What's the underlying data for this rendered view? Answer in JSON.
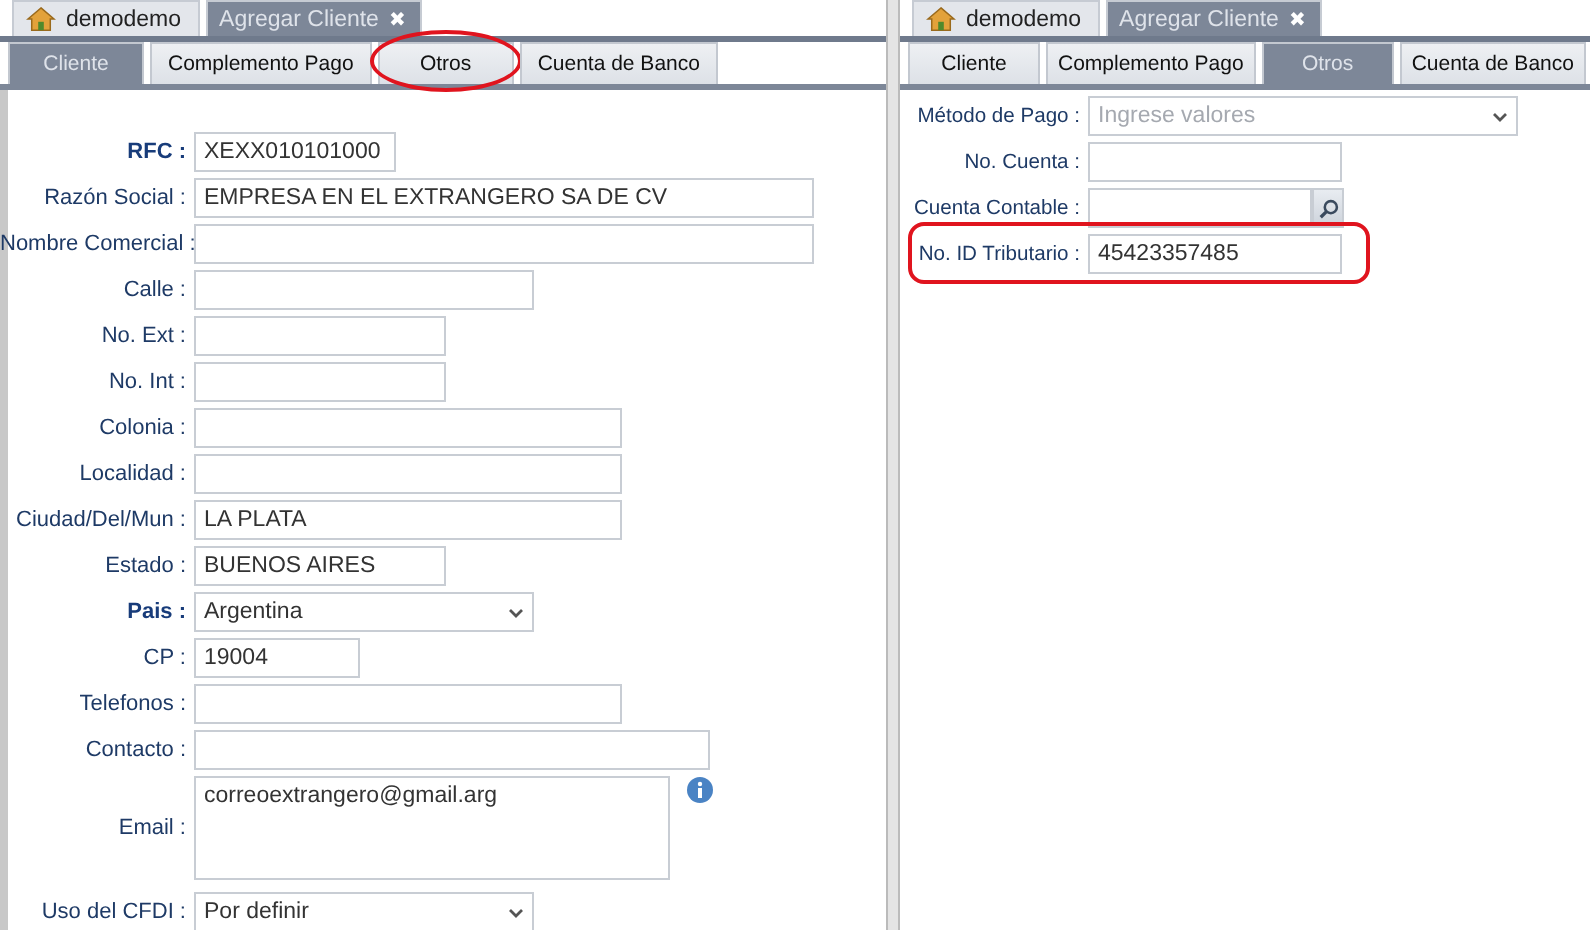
{
  "panes": [
    {
      "top_tabs": [
        {
          "label": "demodemo",
          "selected": false
        },
        {
          "label": "Agregar Cliente",
          "close": "✖",
          "selected": true
        }
      ],
      "sub_tabs": [
        {
          "label": "Cliente",
          "selected": true,
          "highlighted": false
        },
        {
          "label": "Complemento Pago",
          "selected": false,
          "highlighted": false
        },
        {
          "label": "Otros",
          "selected": false,
          "highlighted": true
        },
        {
          "label": "Cuenta de Banco",
          "selected": false,
          "highlighted": false
        }
      ],
      "fields": [
        {
          "label": "RFC :",
          "kind": "text",
          "value": "XEXX010101000",
          "required": true,
          "highlighted": false
        },
        {
          "label": "Razón Social :",
          "kind": "text",
          "value": "EMPRESA EN EL EXTRANGERO SA DE CV",
          "required": false,
          "highlighted": false
        },
        {
          "label": "Nombre Comercial :",
          "kind": "text",
          "required": false,
          "highlighted": false
        },
        {
          "label": "Calle :",
          "kind": "text",
          "required": false,
          "highlighted": false
        },
        {
          "label": "No. Ext :",
          "kind": "text",
          "required": false,
          "highlighted": false
        },
        {
          "label": "No. Int :",
          "kind": "text",
          "required": false,
          "highlighted": false
        },
        {
          "label": "Colonia :",
          "kind": "text",
          "required": false,
          "highlighted": false
        },
        {
          "label": "Localidad :",
          "kind": "text",
          "required": false,
          "highlighted": false
        },
        {
          "label": "Ciudad/Del/Mun :",
          "kind": "text",
          "value": "LA PLATA",
          "required": false,
          "highlighted": false
        },
        {
          "label": "Estado :",
          "kind": "text",
          "value": "BUENOS AIRES",
          "required": false,
          "highlighted": false
        },
        {
          "label": "Pais :",
          "kind": "select",
          "value": "Argentina",
          "required": true,
          "highlighted": false
        },
        {
          "label": "CP :",
          "kind": "text",
          "value": "19004",
          "required": false,
          "highlighted": false
        },
        {
          "label": "Telefonos :",
          "kind": "text",
          "required": false,
          "highlighted": false
        },
        {
          "label": "Contacto :",
          "kind": "text",
          "required": false,
          "highlighted": false
        },
        {
          "label": "Email :",
          "kind": "textarea",
          "value": "correoextrangero@gmail.arg",
          "info": true,
          "required": false,
          "highlighted": false
        },
        {
          "label": "Uso del CFDI :",
          "kind": "select",
          "value": "Por definir",
          "required": false,
          "highlighted": false
        }
      ]
    },
    {
      "top_tabs": [
        {
          "label": "demodemo",
          "selected": false
        },
        {
          "label": "Agregar Cliente",
          "close": "✖",
          "selected": true
        }
      ],
      "sub_tabs": [
        {
          "label": "Cliente",
          "selected": false,
          "highlighted": false
        },
        {
          "label": "Complemento Pago",
          "selected": false,
          "highlighted": false
        },
        {
          "label": "Otros",
          "selected": true,
          "highlighted": false
        },
        {
          "label": "Cuenta de Banco",
          "selected": false,
          "highlighted": false
        }
      ],
      "fields": [
        {
          "label": "Método de Pago :",
          "kind": "select",
          "placeholder": "Ingrese valores",
          "required": false,
          "highlighted": false
        },
        {
          "label": "No. Cuenta :",
          "kind": "text",
          "required": false,
          "highlighted": false
        },
        {
          "label": "Cuenta Contable :",
          "kind": "lookup",
          "required": false,
          "highlighted": false
        },
        {
          "label": "No. ID Tributario :",
          "kind": "text",
          "value": "45423357485",
          "required": false,
          "highlighted": true
        }
      ]
    }
  ]
}
